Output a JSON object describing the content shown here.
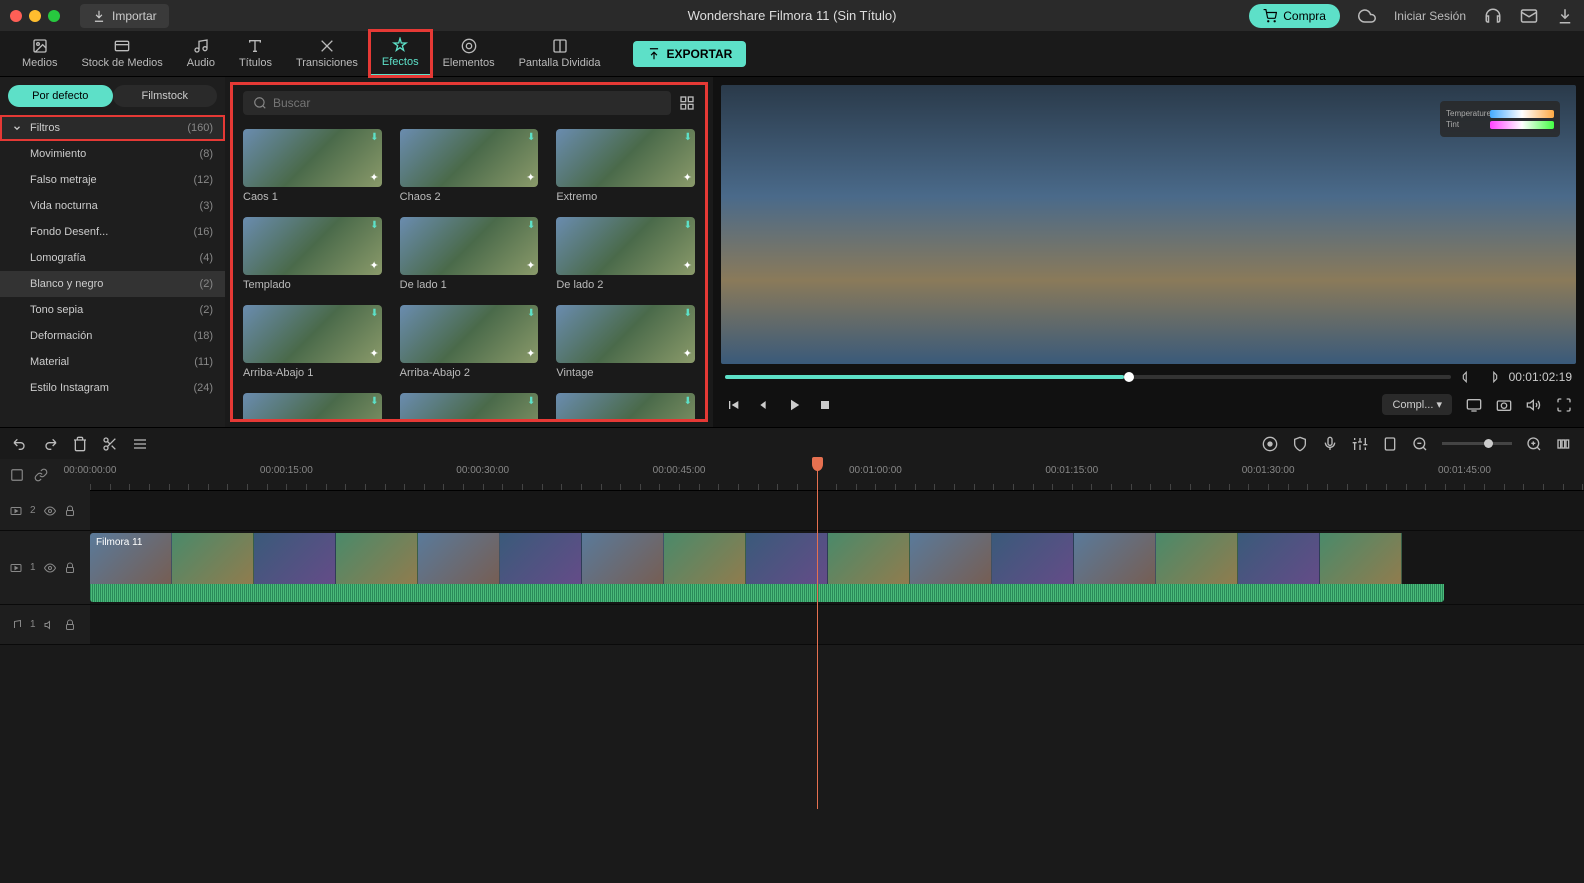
{
  "topbar": {
    "import": "Importar",
    "title": "Wondershare Filmora 11 (Sin Título)",
    "buy": "Compra",
    "login": "Iniciar Sesión"
  },
  "tabs": {
    "media": "Medios",
    "stock": "Stock de Medios",
    "audio": "Audio",
    "titles": "Títulos",
    "transitions": "Transiciones",
    "effects": "Efectos",
    "elements": "Elementos",
    "split": "Pantalla Dividida",
    "export": "EXPORTAR"
  },
  "sidebar": {
    "default_tab": "Por defecto",
    "filmstock_tab": "Filmstock",
    "header": {
      "label": "Filtros",
      "count": "(160)"
    },
    "items": [
      {
        "label": "Movimiento",
        "count": "(8)"
      },
      {
        "label": "Falso metraje",
        "count": "(12)"
      },
      {
        "label": "Vida nocturna",
        "count": "(3)"
      },
      {
        "label": "Fondo Desenf...",
        "count": "(16)"
      },
      {
        "label": "Lomografía",
        "count": "(4)"
      },
      {
        "label": "Blanco y negro",
        "count": "(2)"
      },
      {
        "label": "Tono sepia",
        "count": "(2)"
      },
      {
        "label": "Deformación",
        "count": "(18)"
      },
      {
        "label": "Material",
        "count": "(11)"
      },
      {
        "label": "Estilo Instagram",
        "count": "(24)"
      }
    ]
  },
  "search": {
    "placeholder": "Buscar"
  },
  "effects": [
    "Caos 1",
    "Chaos 2",
    "Extremo",
    "Templado",
    "De lado 1",
    "De lado 2",
    "Arriba-Abajo 1",
    "Arriba-Abajo 2",
    "Vintage",
    "",
    "",
    ""
  ],
  "preview": {
    "adj_temp": "Temperature",
    "adj_tint": "Tint",
    "timecode": "00:01:02:19",
    "quality": "Compl..."
  },
  "ruler": [
    "00:00:00:00",
    "00:00:15:00",
    "00:00:30:00",
    "00:00:45:00",
    "00:01:00:00",
    "00:01:15:00",
    "00:01:30:00",
    "00:01:45:00"
  ],
  "tracks": {
    "v2": "2",
    "v1": "1",
    "a1": "1",
    "clip_label": "Filmora 11"
  }
}
